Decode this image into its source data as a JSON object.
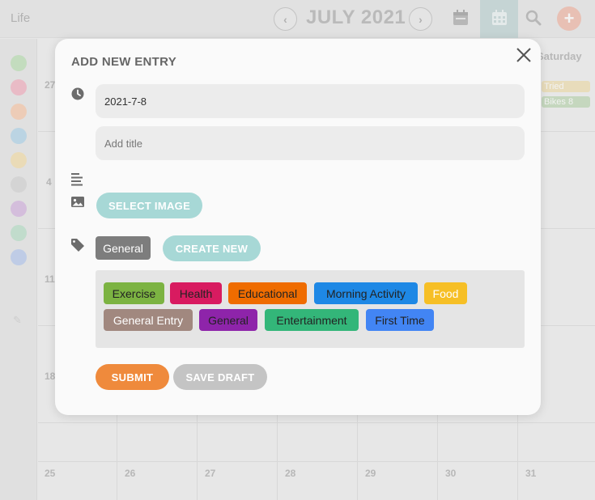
{
  "app": {
    "name": "Life"
  },
  "header": {
    "month_title": "JULY 2021",
    "prev_label": "‹",
    "next_label": "›",
    "add_label": "+"
  },
  "sidebar": {
    "dot_colors": [
      "#b6dcae",
      "#f0a9bb",
      "#f6c4a4",
      "#a9cfe6",
      "#f1dba4",
      "#cfcfcf",
      "#cfaedc",
      "#b3dcc4",
      "#b0c4ec"
    ]
  },
  "calendar": {
    "saturday_header": "Saturday",
    "day_numbers": [
      "27",
      "4",
      "11",
      "18",
      "25",
      "26",
      "27",
      "28",
      "29",
      "30",
      "31"
    ],
    "mini_events": [
      {
        "label": "Tried",
        "color": "#eedcaa"
      },
      {
        "label": "Bikes 8",
        "color": "#b9d5ae"
      }
    ]
  },
  "modal": {
    "title": "ADD NEW ENTRY",
    "date_value": "2021-7-8",
    "title_placeholder": "Add title",
    "select_image_label": "SELECT IMAGE",
    "selected_tag": "General",
    "create_new_label": "CREATE NEW",
    "tags": [
      {
        "label": "Exercise",
        "color": "#7cb342",
        "text_color": "#222222"
      },
      {
        "label": "Health",
        "color": "#d81b60",
        "text_color": "#222222"
      },
      {
        "label": "Educational",
        "color": "#ef6c00",
        "text_color": "#222222"
      },
      {
        "label": "Morning Activity",
        "color": "#1e88e5",
        "text_color": "#222222"
      },
      {
        "label": "Food",
        "color": "#f6bf26",
        "text_color": "#ffffff"
      },
      {
        "label": "General Entry",
        "color": "#a1887f",
        "text_color": "#ffffff"
      },
      {
        "label": "General",
        "color": "#8e24aa",
        "text_color": "#222222"
      },
      {
        "label": "Entertainment",
        "color": "#33b679",
        "text_color": "#222222"
      },
      {
        "label": "First Time",
        "color": "#4285f4",
        "text_color": "#222222"
      }
    ],
    "submit_label": "SUBMIT",
    "save_draft_label": "SAVE DRAFT",
    "colors": {
      "accent_teal": "#a7d8d6",
      "submit_orange": "#ef8a3c",
      "draft_gray": "#c4c4c4"
    }
  }
}
